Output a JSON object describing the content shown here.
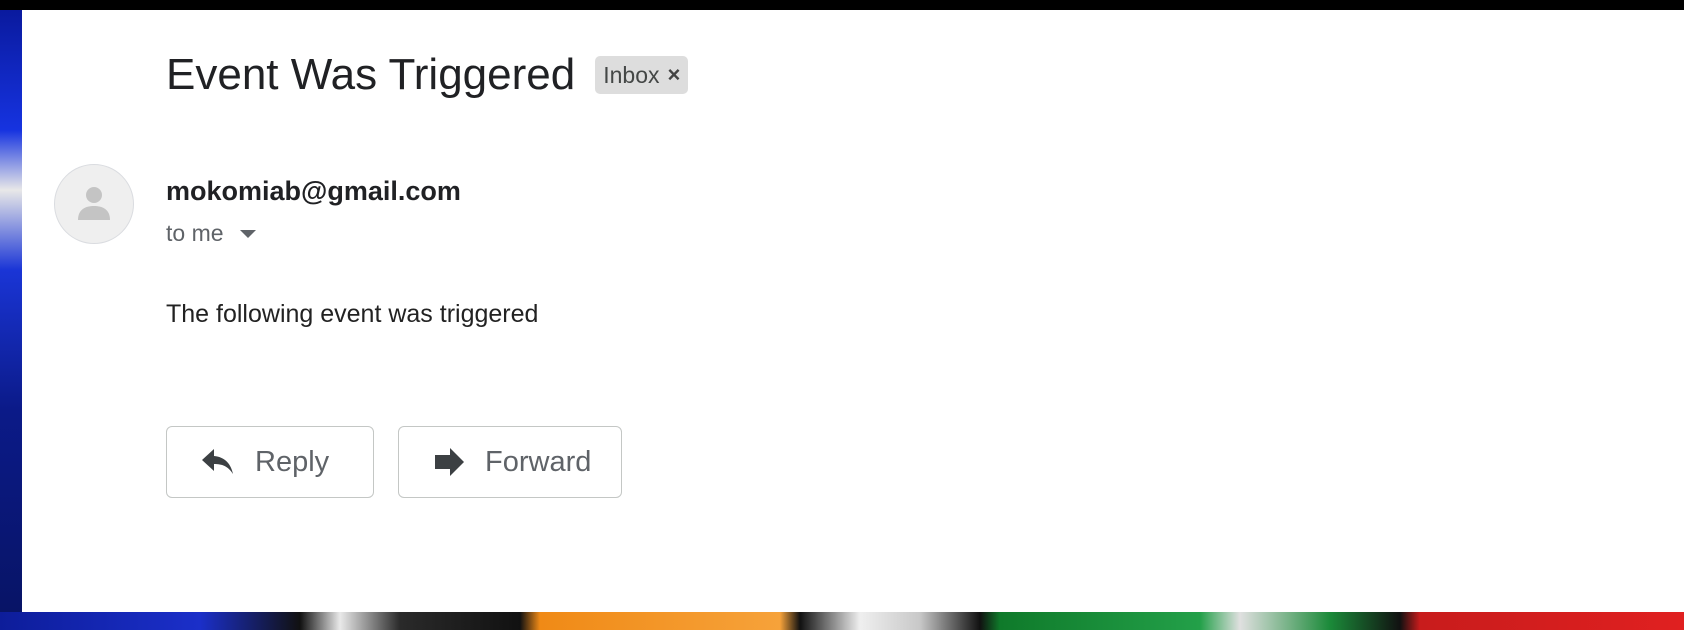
{
  "email": {
    "subject": "Event Was Triggered",
    "label": "Inbox",
    "label_close_glyph": "×",
    "sender": "mokomiab@gmail.com",
    "recipient": "to me",
    "body": "The following event was triggered"
  },
  "actions": {
    "reply_label": "Reply",
    "forward_label": "Forward"
  },
  "icons": {
    "avatar": "person-icon",
    "recipient_dropdown": "caret-down-icon",
    "reply": "reply-arrow-icon",
    "forward": "forward-arrow-icon",
    "label_remove": "close-icon"
  },
  "colors": {
    "subject_text": "#202124",
    "muted_text": "#5f6368",
    "chip_background": "#dddddd",
    "button_border": "#c4c7c5",
    "avatar_background": "#efefef"
  }
}
